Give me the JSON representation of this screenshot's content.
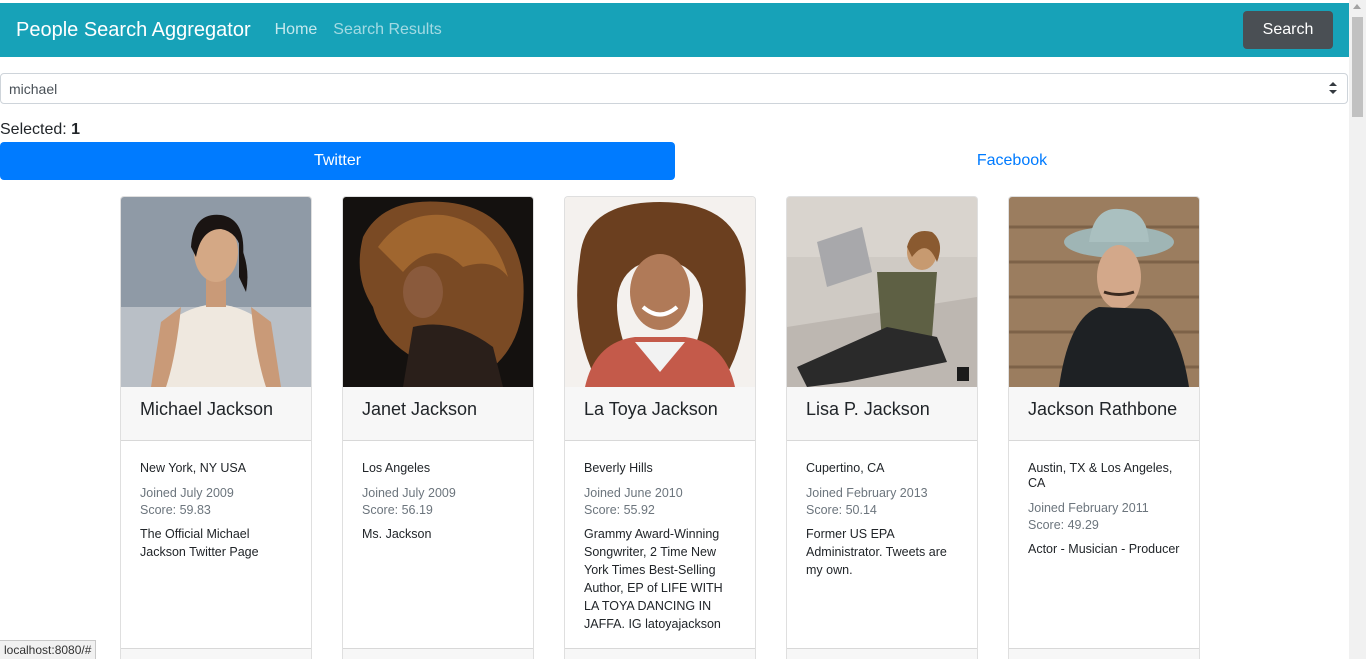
{
  "navbar": {
    "brand": "People Search Aggregator",
    "links": [
      "Home",
      "Search Results"
    ],
    "search_button": "Search",
    "bg_color": "#17a2b8"
  },
  "query_select": {
    "value": "michael"
  },
  "selected": {
    "label": "Selected:",
    "count": "1"
  },
  "tabs": [
    {
      "label": "Twitter",
      "active": true
    },
    {
      "label": "Facebook",
      "active": false
    }
  ],
  "cards": [
    {
      "name": "Michael Jackson",
      "location": "New York, NY USA",
      "joined": "Joined July 2009",
      "score": "Score: 59.83",
      "description": "The Official Michael Jackson Twitter Page"
    },
    {
      "name": "Janet Jackson",
      "location": "Los Angeles",
      "joined": "Joined July 2009",
      "score": "Score: 56.19",
      "description": "Ms. Jackson"
    },
    {
      "name": "La Toya Jackson",
      "location": "Beverly Hills",
      "joined": "Joined June 2010",
      "score": "Score: 55.92",
      "description": "Grammy Award-Winning Songwriter, 2 Time New York Times Best-Selling Author, EP of LIFE WITH LA TOYA DANCING IN JAFFA. IG latoyajackson"
    },
    {
      "name": "Lisa P. Jackson",
      "location": "Cupertino, CA",
      "joined": "Joined February 2013",
      "score": "Score: 50.14",
      "description": "Former US EPA Administrator. Tweets are my own."
    },
    {
      "name": "Jackson Rathbone",
      "location": "Austin, TX & Los Angeles, CA",
      "joined": "Joined February 2011",
      "score": "Score: 49.29",
      "description": "Actor - Musician - Producer"
    }
  ],
  "status_url": "localhost:8080/#"
}
